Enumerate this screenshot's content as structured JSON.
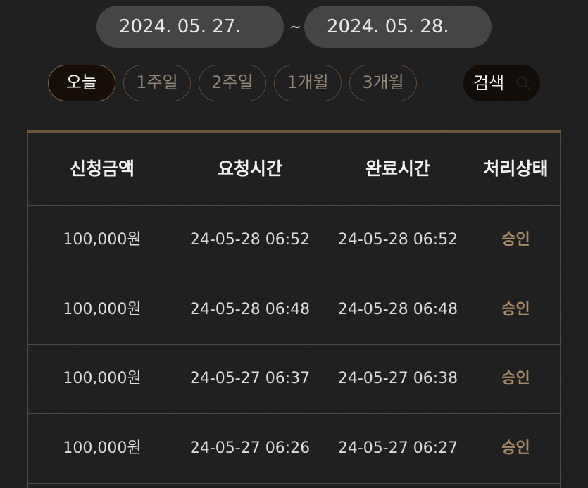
{
  "date_range": {
    "start": "2024. 05. 27.",
    "separator": "~",
    "end": "2024. 05. 28."
  },
  "period_buttons": [
    {
      "label": "오늘",
      "active": true
    },
    {
      "label": "1주일",
      "active": false
    },
    {
      "label": "2주일",
      "active": false
    },
    {
      "label": "1개월",
      "active": false
    },
    {
      "label": "3개월",
      "active": false
    }
  ],
  "search": {
    "label": "검색",
    "icon": "search-icon"
  },
  "table": {
    "headers": [
      "신청금액",
      "요청시간",
      "완료시간",
      "처리상태"
    ],
    "rows": [
      [
        "100,000원",
        "24-05-28 06:52",
        "24-05-28 06:52",
        "승인"
      ],
      [
        "100,000원",
        "24-05-28 06:48",
        "24-05-28 06:48",
        "승인"
      ],
      [
        "100,000원",
        "24-05-27 06:37",
        "24-05-27 06:38",
        "승인"
      ],
      [
        "100,000원",
        "24-05-27 06:26",
        "24-05-27 06:27",
        "승인"
      ]
    ]
  },
  "colors": {
    "accent": "#6e5738",
    "status_approved": "#a88962",
    "active_button_bg": "#160f08"
  }
}
